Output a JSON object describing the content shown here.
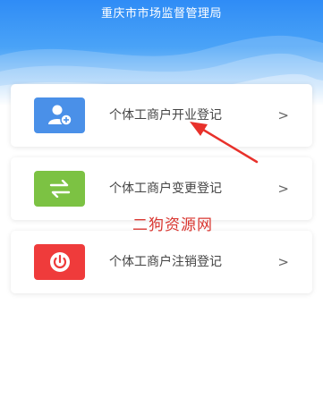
{
  "header": {
    "title": "重庆市市场监督管理局"
  },
  "menu": [
    {
      "label": "个体工商户开业登记",
      "icon": "add-user-icon",
      "color": "#4a90e8"
    },
    {
      "label": "个体工商户变更登记",
      "icon": "exchange-arrows-icon",
      "color": "#7cc243"
    },
    {
      "label": "个体工商户注销登记",
      "icon": "power-icon",
      "color": "#ef3b3b"
    }
  ],
  "chevron": ">",
  "watermark": "二狗资源网",
  "annotation_color": "#e8312b"
}
